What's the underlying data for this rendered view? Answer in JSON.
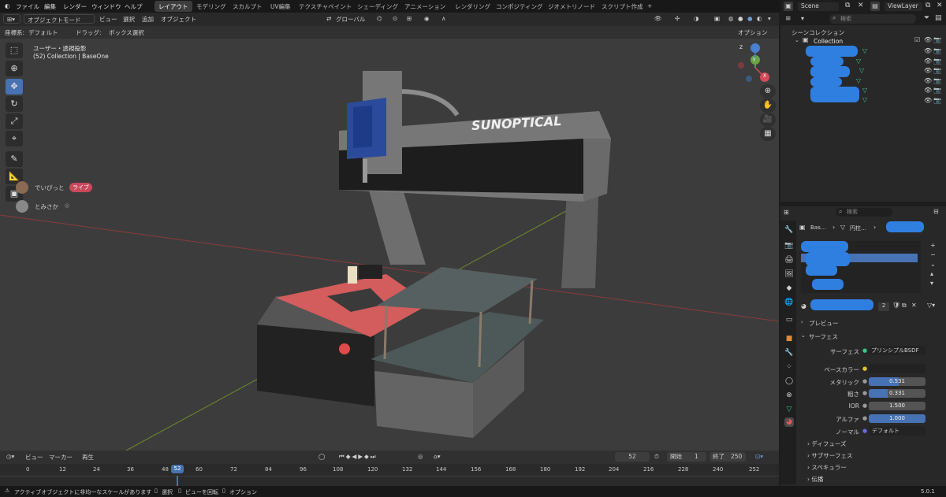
{
  "menu": {
    "items": [
      "ファイル",
      "編集",
      "レンダー",
      "ウィンドウ",
      "ヘルプ"
    ]
  },
  "workspaces": {
    "tabs": [
      "レイアウト",
      "モデリング",
      "スカルプト",
      "UV編集",
      "テクスチャペイント",
      "シェーディング",
      "アニメーション",
      "レンダリング",
      "コンポジティング",
      "ジオメトリノード",
      "スクリプト作成"
    ],
    "add": "+"
  },
  "top_right": {
    "scene": "Scene",
    "view_layer": "ViewLayer"
  },
  "viewport": {
    "mode": "オブジェクトモード",
    "menus": [
      "ビュー",
      "選択",
      "追加",
      "オブジェクト"
    ],
    "transform": "グローバル",
    "coord_label": "座標系:",
    "coord_value": "デフォルト",
    "drag_label": "ドラッグ:",
    "drag_value": "ボックス選択",
    "options": "オプション",
    "info1": "ユーザー・透視投影",
    "info2": "(52) Collection | BaseOne",
    "machine_label": "SUNOPTICAL",
    "users": [
      {
        "name": "でいぴっと",
        "badge": "ライブ"
      },
      {
        "name": "とみさか"
      }
    ],
    "gizmo": {
      "x": "X",
      "y": "Y",
      "z": "Z"
    }
  },
  "outliner": {
    "search": "検索",
    "scene_collection": "シーンコレクション",
    "collection": "Collection"
  },
  "properties": {
    "search": "検索",
    "breadcrumb1": "Bas...",
    "breadcrumb2": "円柱...",
    "slot_count": "2",
    "preview": "プレビュー",
    "surface": "サーフェス",
    "surface_label": "サーフェス",
    "surface_value": "プリンシプルBSDF",
    "base_color": "ベースカラー",
    "rows": [
      {
        "label": "メタリック",
        "value": "0.531"
      },
      {
        "label": "粗さ",
        "value": "0.331"
      },
      {
        "label": "IOR",
        "value": "1.500"
      },
      {
        "label": "アルファ",
        "value": "1.000"
      }
    ],
    "normal_label": "ノーマル",
    "normal_value": "デフォルト",
    "sections": [
      "ディフューズ",
      "サブサーフェス",
      "スペキュラー",
      "伝播"
    ]
  },
  "timeline": {
    "menus": [
      "ビュー",
      "マーカー",
      "再生"
    ],
    "current": "52",
    "start_label": "開始",
    "start": "1",
    "end_label": "終了",
    "end": "250",
    "ticks": [
      "0",
      "12",
      "24",
      "36",
      "48",
      "52",
      "60",
      "72",
      "84",
      "96",
      "108",
      "120",
      "132",
      "144",
      "156",
      "168",
      "180",
      "192",
      "204",
      "216",
      "228",
      "240",
      "252"
    ]
  },
  "status": {
    "warning": "アクティブオブジェクトに非均一なスケールがあります",
    "select": "選択",
    "rotate": "ビューを回転",
    "options": "オプション",
    "version": "5.0.1"
  },
  "colors": {
    "accent": "#4772b3",
    "redact": "#2f7fe0"
  }
}
